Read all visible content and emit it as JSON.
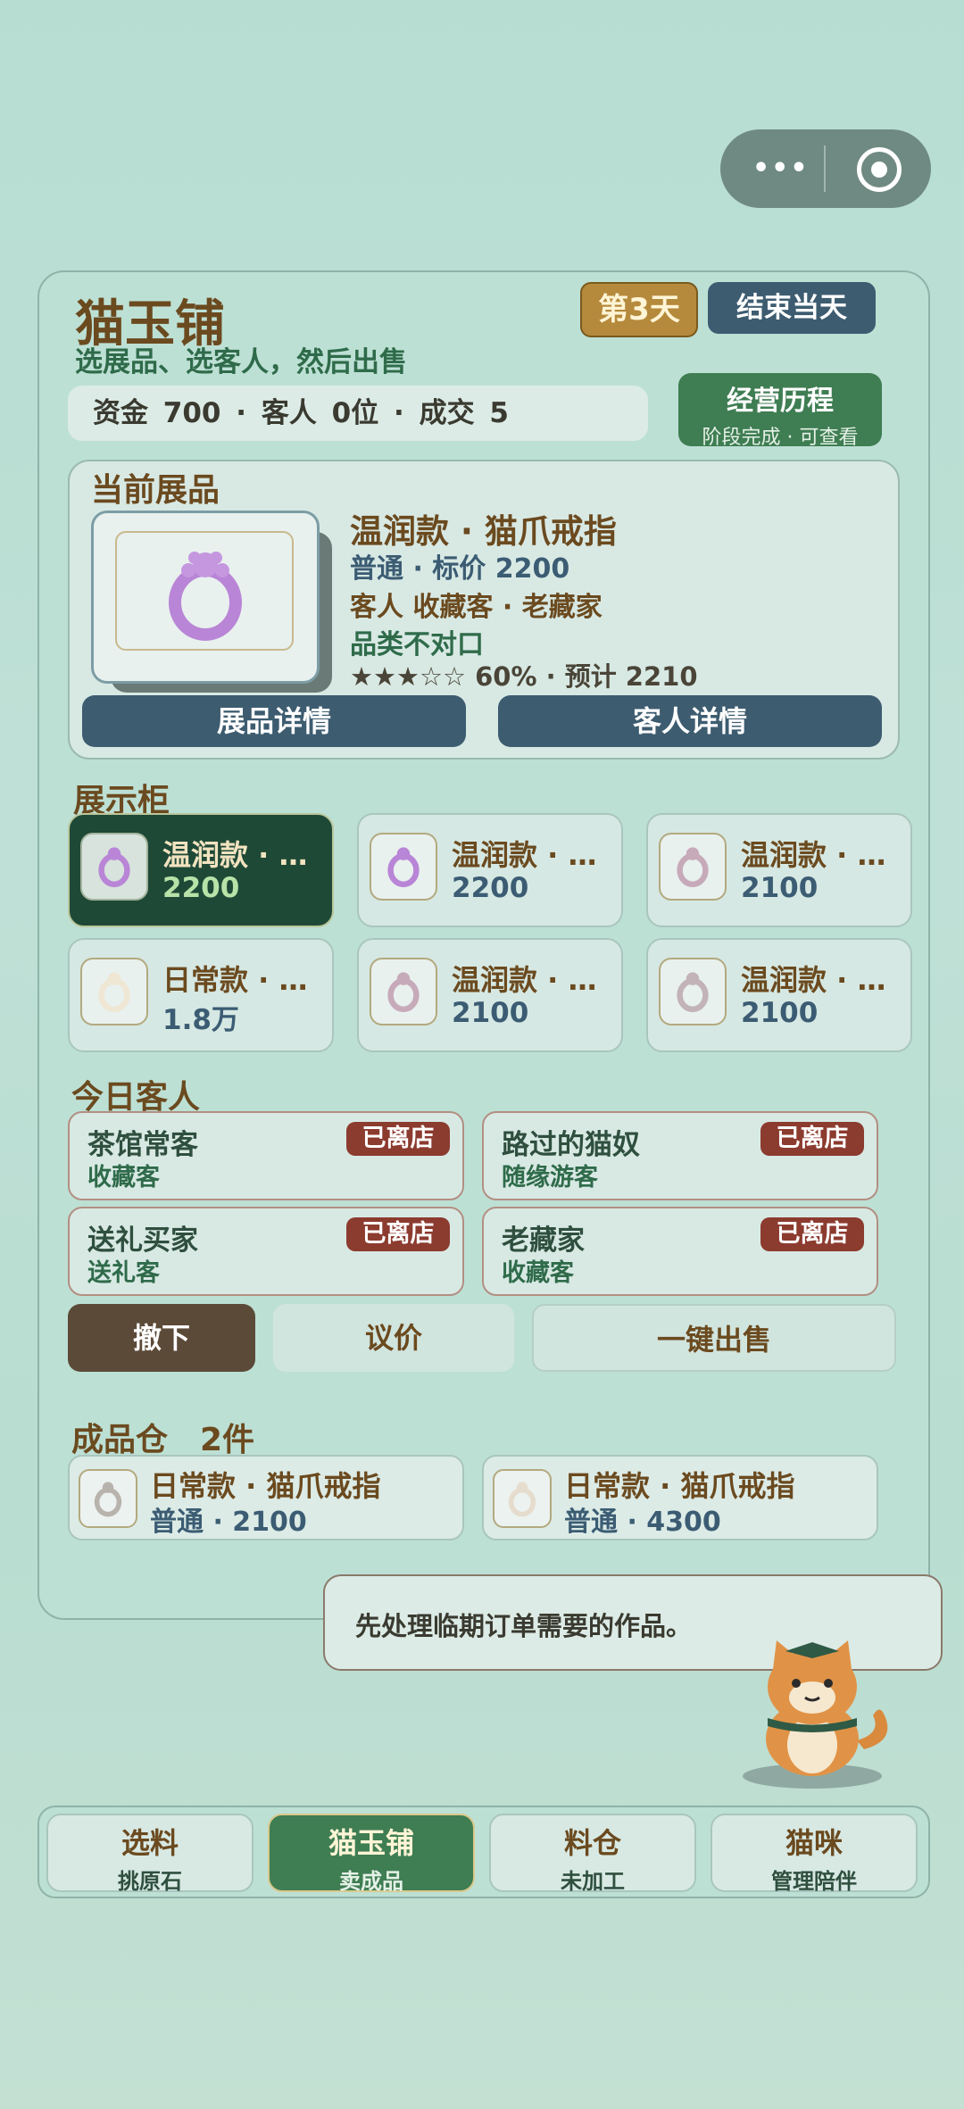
{
  "header": {
    "shop_name": "猫玉铺",
    "subtitle": "选展品、选客人，然后出售",
    "day_badge": "第3天",
    "end_day_button": "结束当天",
    "stats": "资金 700 · 客人 0位 · 成交 5",
    "history_button": {
      "title": "经营历程",
      "subtitle": "阶段完成 · 可查看"
    }
  },
  "exhibit": {
    "section_title": "当前展品",
    "name": "温润款 · 猫爪戒指",
    "grade_price": "普通 · 标价 2200",
    "customer": "客人 收藏客 · 老藏家",
    "category_note": "品类不对口",
    "rating_line": "★★★☆☆ 60% · 预计 2210",
    "item_detail_button": "展品详情",
    "customer_detail_button": "客人详情"
  },
  "showcase": {
    "section_title": "展示柜",
    "items": [
      {
        "name": "温润款 · 猫爪戒指",
        "price": "2200",
        "selected": true,
        "color": "#b985d6"
      },
      {
        "name": "温润款 · 猫爪戒指",
        "price": "2200",
        "selected": false,
        "color": "#b985d6"
      },
      {
        "name": "温润款 · 猫爪戒指",
        "price": "2100",
        "selected": false,
        "color": "#c7aab9"
      },
      {
        "name": "日常款 · 招财猫",
        "price": "1.8万",
        "selected": false,
        "color": "#efe6d4"
      },
      {
        "name": "温润款 · 猫爪戒指",
        "price": "2100",
        "selected": false,
        "color": "#c7aab9"
      },
      {
        "name": "温润款 · 猫爪戒指",
        "price": "2100",
        "selected": false,
        "color": "#c2b3b8"
      }
    ]
  },
  "guests": {
    "section_title": "今日客人",
    "list": [
      {
        "name": "茶馆常客",
        "type": "收藏客",
        "status": "已离店"
      },
      {
        "name": "路过的猫奴",
        "type": "随缘游客",
        "status": "已离店"
      },
      {
        "name": "送礼买家",
        "type": "送礼客",
        "status": "已离店"
      },
      {
        "name": "老藏家",
        "type": "收藏客",
        "status": "已离店"
      }
    ]
  },
  "actions": {
    "remove": "撤下",
    "negotiate": "议价",
    "quick_sell": "一键出售"
  },
  "warehouse": {
    "section_title": "成品仓　2件",
    "items": [
      {
        "name": "日常款 · 猫爪戒指",
        "info": "普通 · 2100",
        "color": "#b9b3ad"
      },
      {
        "name": "日常款 · 猫爪戒指",
        "info": "普通 · 4300",
        "color": "#e6dccd"
      }
    ]
  },
  "speech_bubble": "先处理临期订单需要的作品。",
  "nav": {
    "tabs": [
      {
        "label": "选料",
        "sub": "挑原石",
        "active": false
      },
      {
        "label": "猫玉铺",
        "sub": "卖成品",
        "active": true
      },
      {
        "label": "料仓",
        "sub": "未加工",
        "active": false
      },
      {
        "label": "猫咪",
        "sub": "管理陪伴",
        "active": false
      }
    ]
  },
  "colors": {
    "brown_title": "#6b4a1f",
    "dark_blue_button": "#3d5c70",
    "green_button": "#3f7d53",
    "badge_red": "#8c3b2f",
    "selected_card": "#1f4937"
  }
}
